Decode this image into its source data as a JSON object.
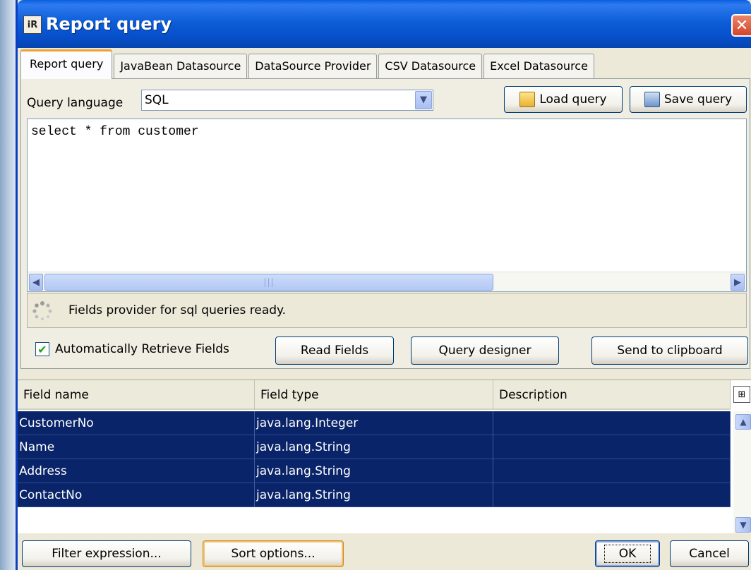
{
  "window": {
    "title": "Report query",
    "close_label": "✕"
  },
  "tabs": [
    {
      "label": "Report query",
      "active": true
    },
    {
      "label": "JavaBean Datasource"
    },
    {
      "label": "DataSource Provider"
    },
    {
      "label": "CSV Datasource"
    },
    {
      "label": "Excel Datasource"
    }
  ],
  "query": {
    "language_label": "Query language",
    "language_value": "SQL",
    "load_label": "Load query",
    "save_label": "Save query",
    "text": "select * from customer"
  },
  "status": {
    "text": "Fields provider for sql queries ready."
  },
  "options": {
    "auto_retrieve_label": "Automatically Retrieve Fields",
    "auto_retrieve_checked": true,
    "read_fields_label": "Read Fields",
    "query_designer_label": "Query designer",
    "send_clipboard_label": "Send to clipboard"
  },
  "fields_table": {
    "columns": [
      "Field name",
      "Field type",
      "Description"
    ],
    "rows": [
      {
        "name": "CustomerNo",
        "type": "java.lang.Integer",
        "description": ""
      },
      {
        "name": "Name",
        "type": "java.lang.String",
        "description": ""
      },
      {
        "name": "Address",
        "type": "java.lang.String",
        "description": ""
      },
      {
        "name": "ContactNo",
        "type": "java.lang.String",
        "description": ""
      }
    ]
  },
  "bottom": {
    "filter_label": "Filter expression...",
    "sort_label": "Sort options...",
    "ok_label": "OK",
    "cancel_label": "Cancel"
  },
  "colors": {
    "title_bar": "#0a5fe0",
    "selection": "#0a246a",
    "dialog_bg": "#ece9d8",
    "active_tab_accent": "#f0a030"
  }
}
